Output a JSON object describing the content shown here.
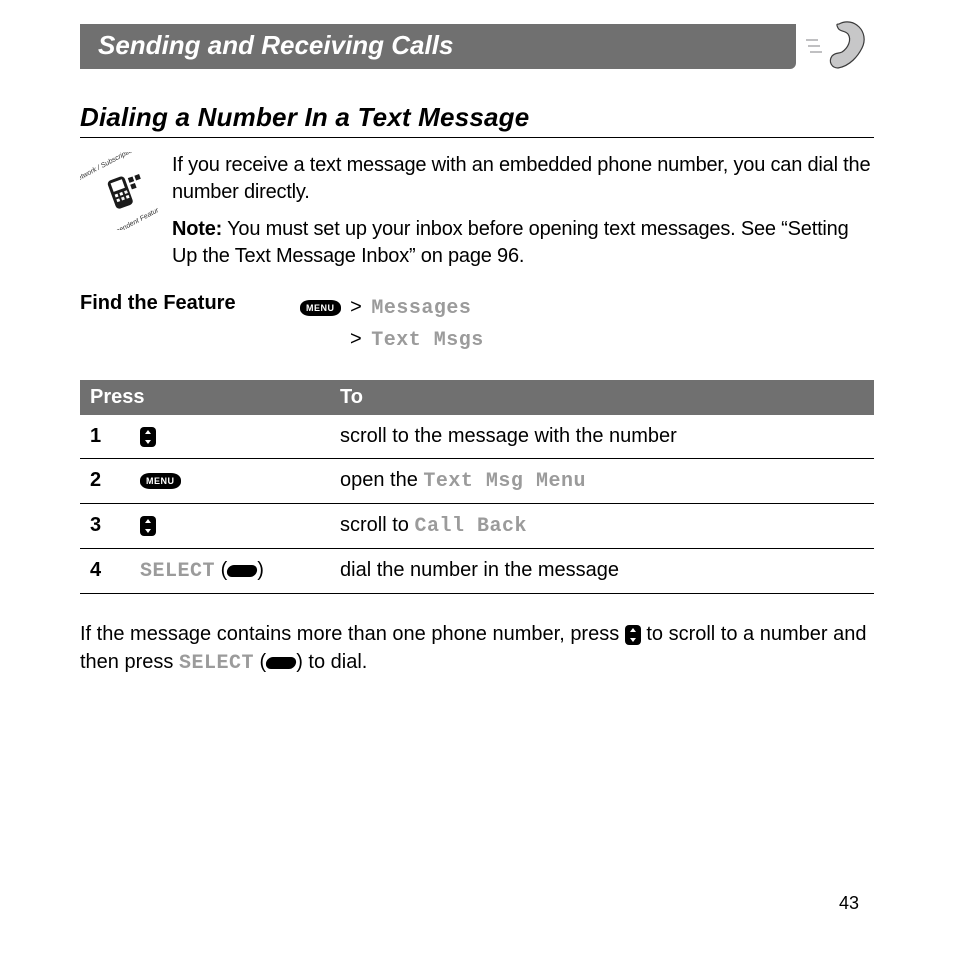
{
  "banner_title": "Sending and Receiving Calls",
  "section_title": "Dialing a Number In a Text Message",
  "intro_para": "If you receive a text message with an embedded phone number, you can dial the number directly.",
  "note_label": "Note:",
  "note_text": " You must set up your inbox before opening text messages. See “Setting Up the Text Message Inbox” on page 96.",
  "find_label": "Find the Feature",
  "menu_key_text": "MENU",
  "path_line1_a": "> ",
  "path_line1_b": "Messages",
  "path_line2_a": "> ",
  "path_line2_b": "Text Msgs",
  "table": {
    "header_press": "Press",
    "header_to": "To",
    "rows": [
      {
        "num": "1",
        "press_type": "scroll",
        "to_pre": "scroll to the message with the number",
        "to_mono": "",
        "to_post": ""
      },
      {
        "num": "2",
        "press_type": "menu",
        "to_pre": "open the ",
        "to_mono": "Text Msg Menu",
        "to_post": ""
      },
      {
        "num": "3",
        "press_type": "scroll",
        "to_pre": "scroll to ",
        "to_mono": "Call Back",
        "to_post": ""
      },
      {
        "num": "4",
        "press_type": "select",
        "press_label": "SELECT",
        "to_pre": "dial the number in the message",
        "to_mono": "",
        "to_post": ""
      }
    ]
  },
  "footer_para_a": "If the message contains more than one phone number, press ",
  "footer_para_b": " to scroll to a number and then press ",
  "footer_select": "SELECT",
  "footer_para_c": " (",
  "footer_para_d": ") to dial.",
  "page_number": "43"
}
